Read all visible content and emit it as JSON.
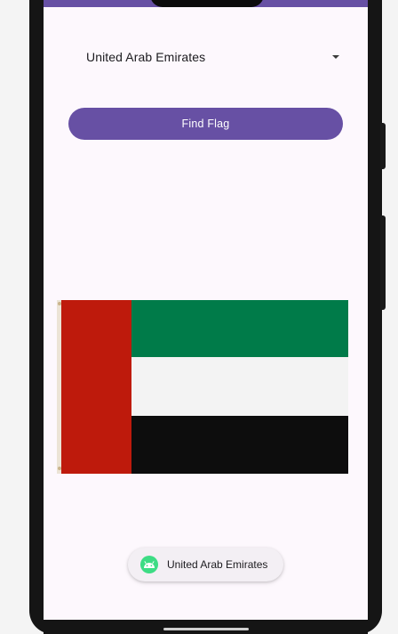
{
  "country_select": {
    "selected": "United Arab Emirates",
    "icon": "chevron-down-icon"
  },
  "find_button": {
    "label": "Find Flag"
  },
  "flag": {
    "country": "United Arab Emirates",
    "colors": {
      "red": "#be1a0c",
      "green": "#007b49",
      "white": "#f3f3f3",
      "black": "#0d0d0d"
    }
  },
  "toast": {
    "text": "United Arab Emirates",
    "icon": "android-icon"
  },
  "theme": {
    "accent": "#6750a4",
    "background": "#fdf8fd"
  }
}
